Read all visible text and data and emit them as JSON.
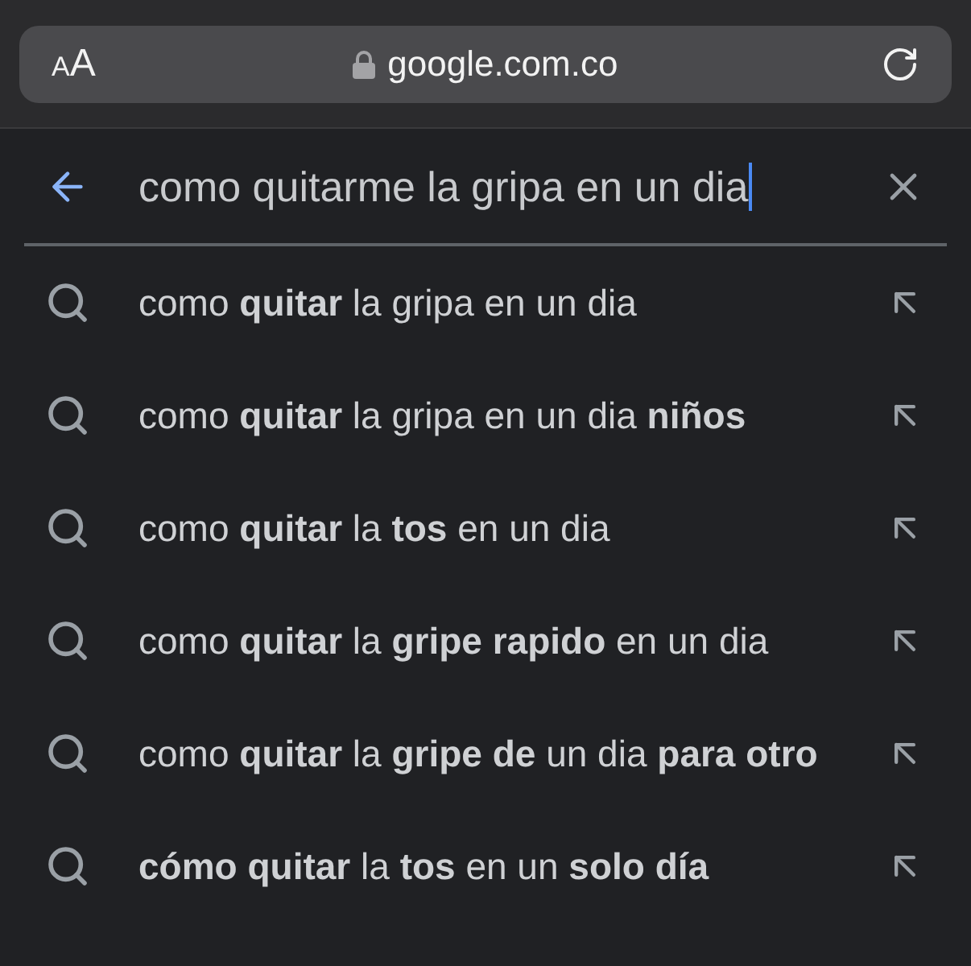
{
  "address_bar": {
    "text_size_label": "AA",
    "url": "google.com.co"
  },
  "search": {
    "value": "como quitarme la gripa en un dia",
    "focused": true
  },
  "suggestions": [
    {
      "text": "como **quitar** la gripa en un dia"
    },
    {
      "text": "como **quitar** la gripa en un dia **niños**"
    },
    {
      "text": "como **quitar** la **tos** en un dia"
    },
    {
      "text": "como **quitar** la **gripe rapido** en un dia"
    },
    {
      "text": "como **quitar** la **gripe de** un dia **para otro**"
    },
    {
      "text": "**cómo quitar** la **tos** en un **solo día**"
    }
  ]
}
